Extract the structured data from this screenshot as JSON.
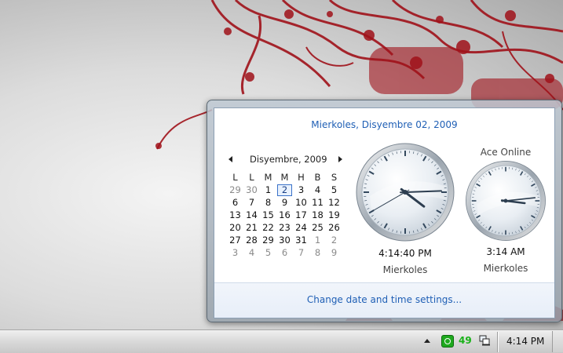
{
  "flyout": {
    "long_date": "Mierkoles, Disyembre 02, 2009",
    "settings_link": "Change date and time settings..."
  },
  "calendar": {
    "month_title": "Disyembre, 2009",
    "weekdays": [
      "L",
      "L",
      "M",
      "M",
      "H",
      "B",
      "S"
    ],
    "today": "2",
    "weeks": [
      [
        {
          "d": "29",
          "o": true
        },
        {
          "d": "30",
          "o": true
        },
        {
          "d": "1"
        },
        {
          "d": "2",
          "t": true
        },
        {
          "d": "3"
        },
        {
          "d": "4"
        },
        {
          "d": "5"
        }
      ],
      [
        {
          "d": "6"
        },
        {
          "d": "7"
        },
        {
          "d": "8"
        },
        {
          "d": "9"
        },
        {
          "d": "10"
        },
        {
          "d": "11"
        },
        {
          "d": "12"
        }
      ],
      [
        {
          "d": "13"
        },
        {
          "d": "14"
        },
        {
          "d": "15"
        },
        {
          "d": "16"
        },
        {
          "d": "17"
        },
        {
          "d": "18"
        },
        {
          "d": "19"
        }
      ],
      [
        {
          "d": "20"
        },
        {
          "d": "21"
        },
        {
          "d": "22"
        },
        {
          "d": "23"
        },
        {
          "d": "24"
        },
        {
          "d": "25"
        },
        {
          "d": "26"
        }
      ],
      [
        {
          "d": "27"
        },
        {
          "d": "28"
        },
        {
          "d": "29"
        },
        {
          "d": "30"
        },
        {
          "d": "31"
        },
        {
          "d": "1",
          "o": true
        },
        {
          "d": "2",
          "o": true
        }
      ],
      [
        {
          "d": "3",
          "o": true
        },
        {
          "d": "4",
          "o": true
        },
        {
          "d": "5",
          "o": true
        },
        {
          "d": "6",
          "o": true
        },
        {
          "d": "7",
          "o": true
        },
        {
          "d": "8",
          "o": true
        },
        {
          "d": "9",
          "o": true
        }
      ]
    ]
  },
  "clocks": {
    "main": {
      "time": "4:14:40 PM",
      "day": "Mierkoles",
      "hours": 4,
      "minutes": 14,
      "seconds": 40
    },
    "second": {
      "name": "Ace Online",
      "time": "3:14 AM",
      "day": "Mierkoles",
      "hours": 3,
      "minutes": 14
    }
  },
  "taskbar": {
    "tray_count": "49",
    "clock": "4:14 PM",
    "icons": [
      "show-hidden-icons-arrow-icon",
      "green-app-icon",
      "network-icon"
    ]
  },
  "colors": {
    "link": "#1f5fb5",
    "wallpaper_accent": "#a0121a",
    "tray_count": "#18b218"
  }
}
